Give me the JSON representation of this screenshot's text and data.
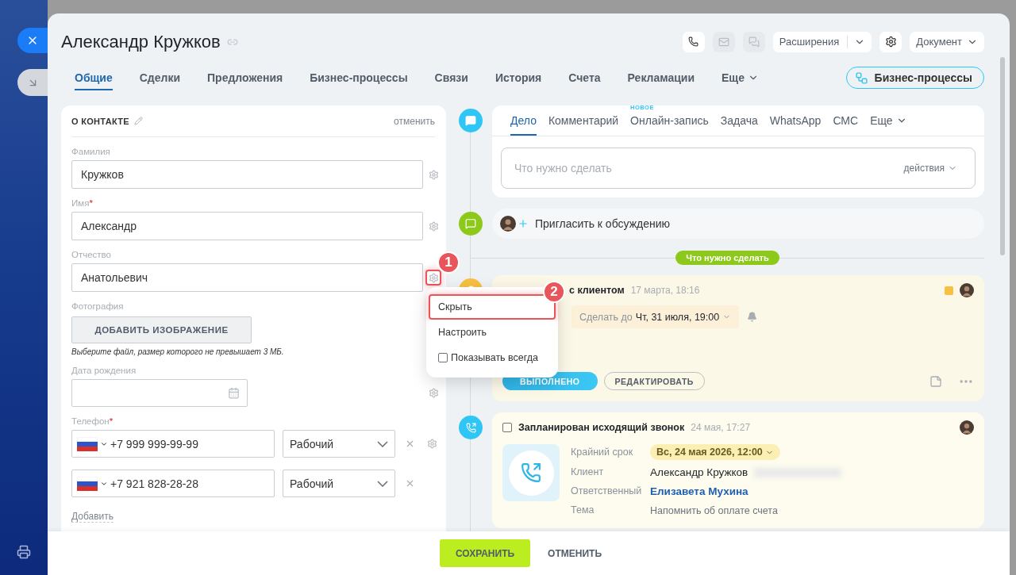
{
  "header": {
    "title": "Александр Кружков",
    "icon_buttons": [
      {
        "kind": "phone",
        "disabled": false
      },
      {
        "kind": "mail",
        "disabled": true
      },
      {
        "kind": "chat",
        "disabled": true
      }
    ],
    "extensions": "Расширения",
    "document": "Документ"
  },
  "tabs": [
    {
      "label": "Общие",
      "selected": true,
      "kind": "tab"
    },
    {
      "label": "Сделки",
      "selected": false,
      "kind": "tab"
    },
    {
      "label": "Предложения",
      "selected": false,
      "kind": "tab"
    },
    {
      "label": "Бизнес-процессы",
      "selected": false,
      "kind": "tab"
    },
    {
      "label": "Связи",
      "selected": false,
      "kind": "tab"
    },
    {
      "label": "История",
      "selected": false,
      "kind": "tab"
    },
    {
      "label": "Счета",
      "selected": false,
      "kind": "tab"
    },
    {
      "label": "Рекламации",
      "selected": false,
      "kind": "tab"
    },
    {
      "label": "Еще",
      "selected": false,
      "kind": "more"
    }
  ],
  "bp_button": "Бизнес-процессы",
  "contact_card": {
    "title": "О КОНТАКТЕ",
    "cancel": "отменить",
    "fields": [
      {
        "kind": "text",
        "label": "Фамилия",
        "value": "Кружков",
        "highlighted": false
      },
      {
        "kind": "text",
        "label": "Имя",
        "required_mark": "*",
        "value": "Александр",
        "highlighted": false
      },
      {
        "kind": "text",
        "label": "Отчество",
        "value": "Анатольевич",
        "highlighted": true
      },
      {
        "kind": "photo",
        "label": "Фотография",
        "button": "ДОБАВИТЬ ИЗОБРАЖЕНИЕ",
        "hint": "Выберите файл, размер которого не превышает 3 МБ."
      },
      {
        "kind": "date",
        "label": "Дата рождения",
        "highlighted": false
      },
      {
        "kind": "phone",
        "label": "Телефон",
        "required_mark": "*",
        "highlighted": false,
        "phones": [
          {
            "number": "+7 999 999-99-99",
            "type": "Рабочий"
          },
          {
            "number": "+7 921 828-28-28",
            "type": "Рабочий"
          }
        ],
        "add": "Добавить"
      }
    ]
  },
  "context_menu": {
    "items": [
      {
        "kind": "action",
        "label": "Скрыть",
        "highlighted": true
      },
      {
        "kind": "action",
        "label": "Настроить",
        "highlighted": false
      },
      {
        "kind": "checkbox",
        "label": "Показывать всегда",
        "checked": false
      }
    ]
  },
  "callouts": [
    {
      "label": "1"
    },
    {
      "label": "2"
    }
  ],
  "composer": {
    "tabs": [
      {
        "label": "Дело",
        "selected": true
      },
      {
        "label": "Комментарий",
        "selected": false
      },
      {
        "label": "Онлайн-запись",
        "selected": false,
        "badge": "НОВОЕ"
      },
      {
        "label": "Задача",
        "selected": false
      },
      {
        "label": "WhatsApp",
        "selected": false
      },
      {
        "label": "СМС",
        "selected": false
      },
      {
        "label": "Еще",
        "selected": false,
        "kind": "more"
      }
    ],
    "placeholder": "Что нужно сделать",
    "actions": "действия"
  },
  "invite": "Пригласить к обсуждению",
  "section_label": "Что нужно сделать",
  "items": [
    {
      "kind": "task",
      "title": "с клиентом",
      "time": "17 марта, 18:16",
      "deadline_label": "Сделать до",
      "deadline": "Чт, 31 июля, 19:00",
      "buttons": [
        "ВЫПОЛНЕНО",
        "РЕДАКТИРОВАТЬ"
      ]
    },
    {
      "kind": "call",
      "title": "Запланирован исходящий звонок",
      "time": "24 мая, 17:27",
      "checked": false,
      "rows": [
        {
          "kind": "date",
          "label": "Крайний срок",
          "value": "Вс, 24 мая 2026, 12:00"
        },
        {
          "kind": "client",
          "label": "Клиент",
          "value": "Александр Кружков"
        },
        {
          "kind": "link",
          "label": "Ответственный",
          "value": "Елизавета Мухина"
        },
        {
          "kind": "text",
          "label": "Тема",
          "value": "Напомнить об оплате счета"
        }
      ]
    }
  ],
  "footer": {
    "save": "СОХРАНИТЬ",
    "cancel": "ОТМЕНИТЬ"
  }
}
